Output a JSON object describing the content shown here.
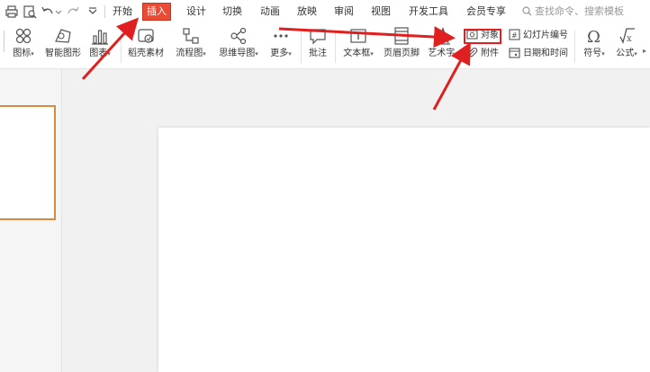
{
  "quick_access": {
    "icons": [
      "print-icon",
      "print-preview-icon",
      "undo-icon",
      "redo-icon",
      "customize-icon"
    ]
  },
  "tabs": [
    {
      "label": "开始"
    },
    {
      "label": "插入"
    },
    {
      "label": "设计"
    },
    {
      "label": "切换"
    },
    {
      "label": "动画"
    },
    {
      "label": "放映"
    },
    {
      "label": "审阅"
    },
    {
      "label": "视图"
    },
    {
      "label": "开发工具"
    },
    {
      "label": "会员专享"
    }
  ],
  "active_tab": "插入",
  "search": {
    "placeholder": "查找命令、搜索模板"
  },
  "ribbon": {
    "icon_lib": "图标",
    "smart_shape": "智能图形",
    "chart": "图表",
    "material": "稻壳素材",
    "flowchart": "流程图",
    "mindmap": "思维导图",
    "more": "更多",
    "comment": "批注",
    "textbox": "文本框",
    "header_footer": "页眉页脚",
    "wordart": "艺术字",
    "object": "对象",
    "attachment": "附件",
    "slide_number": "幻灯片编号",
    "datetime": "日期和时间",
    "symbol": "符号",
    "formula": "公式"
  },
  "colors": {
    "active_tab_bg": "#e94b35",
    "annotation_red": "#e02020",
    "thumb_border": "#d98a3d"
  }
}
